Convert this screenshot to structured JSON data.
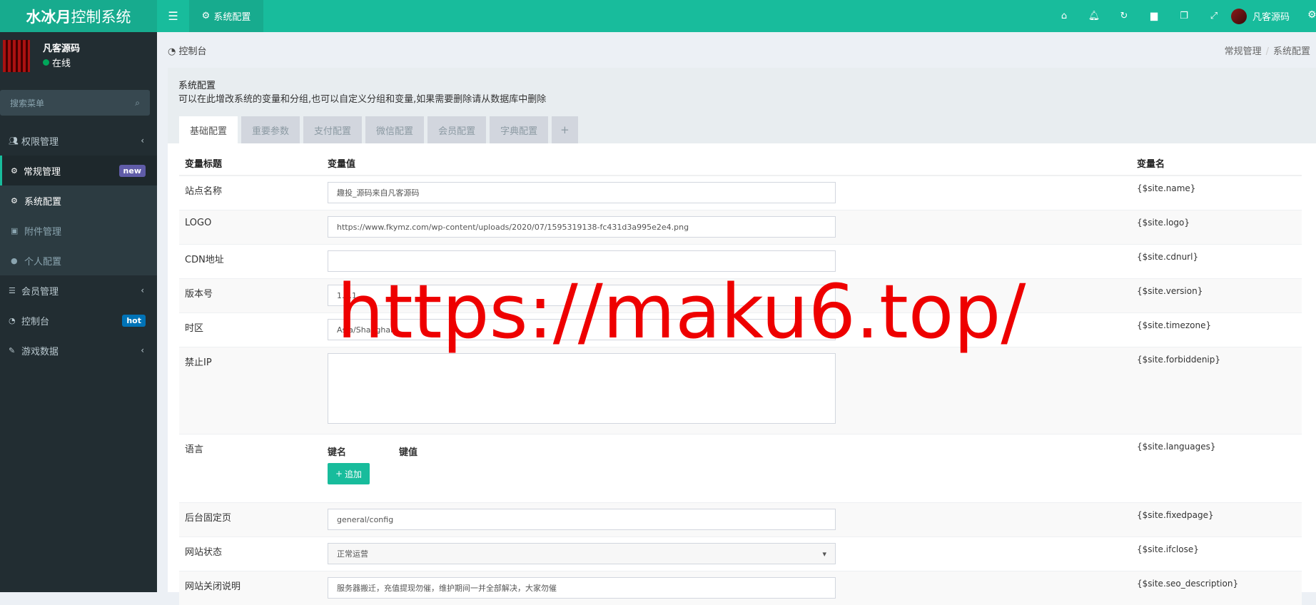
{
  "app": {
    "title_bold": "水冰月",
    "title_rest": "控制系统"
  },
  "topbar": {
    "active_tab": "系统配置",
    "user": "凡客源码"
  },
  "sidebar": {
    "user": {
      "name": "凡客源码",
      "status": "在线"
    },
    "search_placeholder": "搜索菜单",
    "items": [
      {
        "label": "权限管理",
        "icon": "users-icon"
      },
      {
        "label": "常规管理",
        "icon": "cogs-icon",
        "badge": "new"
      },
      {
        "label": "会员管理",
        "icon": "list-icon"
      },
      {
        "label": "控制台",
        "icon": "dashboard-icon",
        "badge": "hot"
      },
      {
        "label": "游戏数据",
        "icon": "magic-icon"
      }
    ],
    "sub_items": [
      {
        "label": "系统配置",
        "icon": "cog-icon"
      },
      {
        "label": "附件管理",
        "icon": "image-icon"
      },
      {
        "label": "个人配置",
        "icon": "user-icon"
      }
    ]
  },
  "breadcrumb": {
    "left": "控制台",
    "right": [
      "常规管理",
      "系统配置"
    ]
  },
  "panel": {
    "title": "系统配置",
    "desc": "可以在此增改系统的变量和分组,也可以自定义分组和变量,如果需要删除请从数据库中删除",
    "tabs": [
      "基础配置",
      "重要参数",
      "支付配置",
      "微信配置",
      "会员配置",
      "字典配置"
    ],
    "tab_add": "+"
  },
  "table": {
    "headers": [
      "变量标题",
      "变量值",
      "变量名"
    ],
    "rows": {
      "site_name": {
        "title": "站点名称",
        "value": "趣投_源码来自凡客源码",
        "var": "{$site.name}"
      },
      "logo": {
        "title": "LOGO",
        "value": "https://www.fkymz.com/wp-content/uploads/2020/07/1595319138-fc431d3a995e2e4.png",
        "var": "{$site.logo}"
      },
      "cdn": {
        "title": "CDN地址",
        "value": "",
        "var": "{$site.cdnurl}"
      },
      "version": {
        "title": "版本号",
        "value": "1.0.1",
        "var": "{$site.version}"
      },
      "timezone": {
        "title": "时区",
        "value": "Asia/Shanghai",
        "var": "{$site.timezone}"
      },
      "forbidden": {
        "title": "禁止IP",
        "value": "",
        "var": "{$site.forbiddenip}"
      },
      "languages": {
        "title": "语言",
        "key_label": "键名",
        "value_label": "键值",
        "add_label": "追加",
        "var": "{$site.languages}"
      },
      "fixedpage": {
        "title": "后台固定页",
        "value": "general/config",
        "var": "{$site.fixedpage}"
      },
      "ifclose": {
        "title": "网站状态",
        "value": "正常运营",
        "var": "{$site.ifclose}"
      },
      "seo": {
        "title": "网站关闭说明",
        "value": "服务器搬迁，充值提现勿催，维护期间一并全部解决，大家勿催",
        "var": "{$site.seo_description}"
      }
    }
  },
  "watermark": "https://maku6.top/"
}
